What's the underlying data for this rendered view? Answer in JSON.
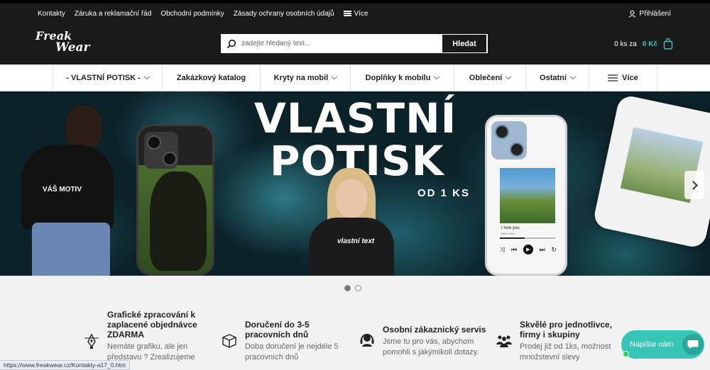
{
  "topbar": {
    "links": [
      "Kontakty",
      "Záruka a reklamační řád",
      "Obchodní podmínky",
      "Zásady ochrany osobních údajů"
    ],
    "more_label": "Více",
    "login_label": "Přihlášení"
  },
  "header": {
    "logo_line1": "Freak",
    "logo_line2": "Wear",
    "search_placeholder": "zadejte hledaný text...",
    "search_button": "Hledat",
    "cart_count_label": "0 ks za",
    "cart_price": "0 Kč"
  },
  "nav": {
    "items": [
      {
        "label": "- VLASTNÍ POTISK -",
        "has_dropdown": true
      },
      {
        "label": "Zakázkový katalog",
        "has_dropdown": false
      },
      {
        "label": "Kryty na mobil",
        "has_dropdown": true
      },
      {
        "label": "Doplňky k mobilu",
        "has_dropdown": true
      },
      {
        "label": "Oblečení",
        "has_dropdown": true
      },
      {
        "label": "Ostatní",
        "has_dropdown": true
      }
    ],
    "more_label": "Více"
  },
  "banner": {
    "title_line1": "VLASTNÍ",
    "title_line2": "POTISK",
    "subtitle": "OD 1 KS",
    "tshirt_text": "VÁŠ MOTIV",
    "hoodie_text": "vlastní text",
    "song_title": "I love you",
    "song_artist": "Billie Eilish",
    "active_slide": 1,
    "slide_count": 2
  },
  "features": [
    {
      "icon": "design-pen-icon",
      "title": "Grafické zpracování k zaplacené objednávce ZDARMA",
      "desc": "Nemáte grafiku, ale jen představu ? Zrealizujeme"
    },
    {
      "icon": "package-icon",
      "title": "Doručení do 3-5 pracovních dnů",
      "desc": "Doba doručení je nejdéle 5 pracovních dnů"
    },
    {
      "icon": "headset-icon",
      "title": "Osobní zákaznický servis",
      "desc": "Jsme tu pro vás, abychom pomohli s jakýmikoli dotazy."
    },
    {
      "icon": "group-icon",
      "title": "Skvělé pro jednotlivce, firmy i skupiny",
      "desc": "Prodej již od 1ks, možnost množstevní slevy"
    }
  ],
  "chat": {
    "label": "Napište nám"
  },
  "statusbar": {
    "url": "https://www.freakwear.cz/Kontakty-a17_0.htm"
  },
  "colors": {
    "accent": "#37c5b8",
    "header_bg": "#1a1a1a"
  }
}
